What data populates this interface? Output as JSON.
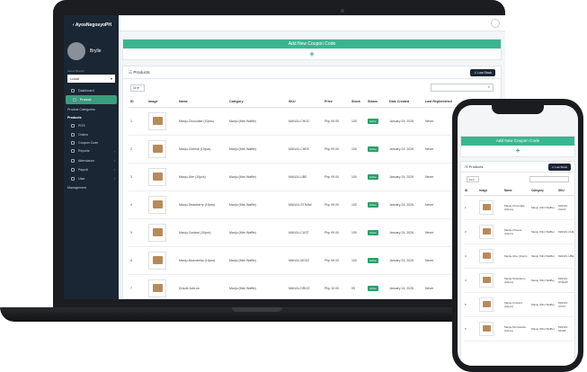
{
  "app": {
    "brand": "AyosNegosyoPH"
  },
  "sidebar": {
    "username": "Brylle",
    "store_label": "Select Branch",
    "store_value": "Lucat",
    "items": [
      {
        "label": "Dashboard",
        "icon": "dashboard-icon"
      },
      {
        "label": "Product",
        "icon": "box-icon",
        "active": true
      },
      {
        "label": "Product Categories"
      },
      {
        "label": "Products"
      },
      {
        "label": "POS",
        "icon": "cart-icon"
      },
      {
        "label": "Orders",
        "icon": "receipt-icon"
      },
      {
        "label": "Coupon Code",
        "icon": "ticket-icon"
      },
      {
        "label": "Reports",
        "icon": "chart-icon"
      },
      {
        "label": "Attendance",
        "icon": "calendar-icon"
      },
      {
        "label": "Payroll",
        "icon": "wallet-icon"
      },
      {
        "label": "User",
        "icon": "user-icon"
      },
      {
        "label": "Management"
      }
    ]
  },
  "coupon": {
    "title": "Add New Coupon Code",
    "plus": "+"
  },
  "products": {
    "title": "Products",
    "low_stock_button": "Low Stock",
    "page_length": "10",
    "columns": [
      "ID",
      "Image",
      "Name",
      "Category",
      "SKU",
      "Price",
      "Stock",
      "Status",
      "Date Created",
      "Last Replenished"
    ],
    "rows": [
      {
        "id": "1",
        "name": "Manju-Chocolate (10pcs)",
        "category": "Manju (Mini Waffle)",
        "sku": "MANJU-CHOC",
        "price": "Php 99.00",
        "stock": "100",
        "status": "Active",
        "date": "January 24, 2026",
        "last": "Never"
      },
      {
        "id": "2",
        "name": "Manju-Cheese (10pcs)",
        "category": "Manju (Mini Waffle)",
        "sku": "MANJU-CHEE",
        "price": "Php 99.00",
        "stock": "100",
        "status": "Active",
        "date": "January 24, 2026",
        "last": "Never"
      },
      {
        "id": "3",
        "name": "Manju-Ube (10pcs)",
        "category": "Manju (Mini Waffle)",
        "sku": "MANJU-UBE",
        "price": "Php 99.00",
        "stock": "100",
        "status": "Active",
        "date": "January 24, 2026",
        "last": "Never"
      },
      {
        "id": "4",
        "name": "Manju-Strawberry (10pcs)",
        "category": "Manju (Mini Waffle)",
        "sku": "MANJU-STRAW",
        "price": "Php 99.00",
        "stock": "100",
        "status": "Active",
        "date": "January 24, 2026",
        "last": "Never"
      },
      {
        "id": "5",
        "name": "Manju-Custard (10pcs)",
        "category": "Manju (Mini Waffle)",
        "sku": "MANJU-CUST",
        "price": "Php 99.00",
        "stock": "100",
        "status": "Active",
        "date": "January 24, 2026",
        "last": "Never"
      },
      {
        "id": "6",
        "name": "Manju-Mozzarella (10pcs)",
        "category": "Manju (Mini Waffle)",
        "sku": "MANJU-MOZZ",
        "price": "Php 99.00",
        "stock": "100",
        "status": "Active",
        "date": "January 24, 2026",
        "last": "Never"
      },
      {
        "id": "7",
        "name": "Drizzle Add-on",
        "category": "Manju (Mini Waffle)",
        "sku": "MANJU-DRIZZ",
        "price": "Php 10.00",
        "stock": "99",
        "status": "Active",
        "date": "January 24, 2026",
        "last": "Never"
      }
    ]
  },
  "phone": {
    "columns": [
      "ID",
      "Image",
      "Name",
      "Category",
      "SKU"
    ],
    "rows": [
      {
        "id": "1",
        "name": "Manju-Chocolate (10pcs)",
        "category": "Manju (Mini Waffle)",
        "sku": "MANJU-CHOC"
      },
      {
        "id": "2",
        "name": "Manju-Cheese (10pcs)",
        "category": "Manju (Mini Waffle)",
        "sku": "MANJU-CHE"
      },
      {
        "id": "3",
        "name": "Manju-Ube (10pcs)",
        "category": "Manju (Mini Waffle)",
        "sku": "MANJU-UBE"
      },
      {
        "id": "4",
        "name": "Manju-Strawberry (10pcs)",
        "category": "Manju (Mini Waffle)",
        "sku": "MANJU-STRAW"
      },
      {
        "id": "5",
        "name": "Manju-Custard (10pcs)",
        "category": "Manju (Mini Waffle)",
        "sku": "MANJU-CUST"
      },
      {
        "id": "6",
        "name": "Manju-Mozzarella (10pcs)",
        "category": "Manju (Mini Waffle)",
        "sku": "MANJU-MOZZ"
      }
    ]
  },
  "colors": {
    "accent": "#3bb58f",
    "sidebar": "#1a2633",
    "status": "#2e9e6b"
  }
}
